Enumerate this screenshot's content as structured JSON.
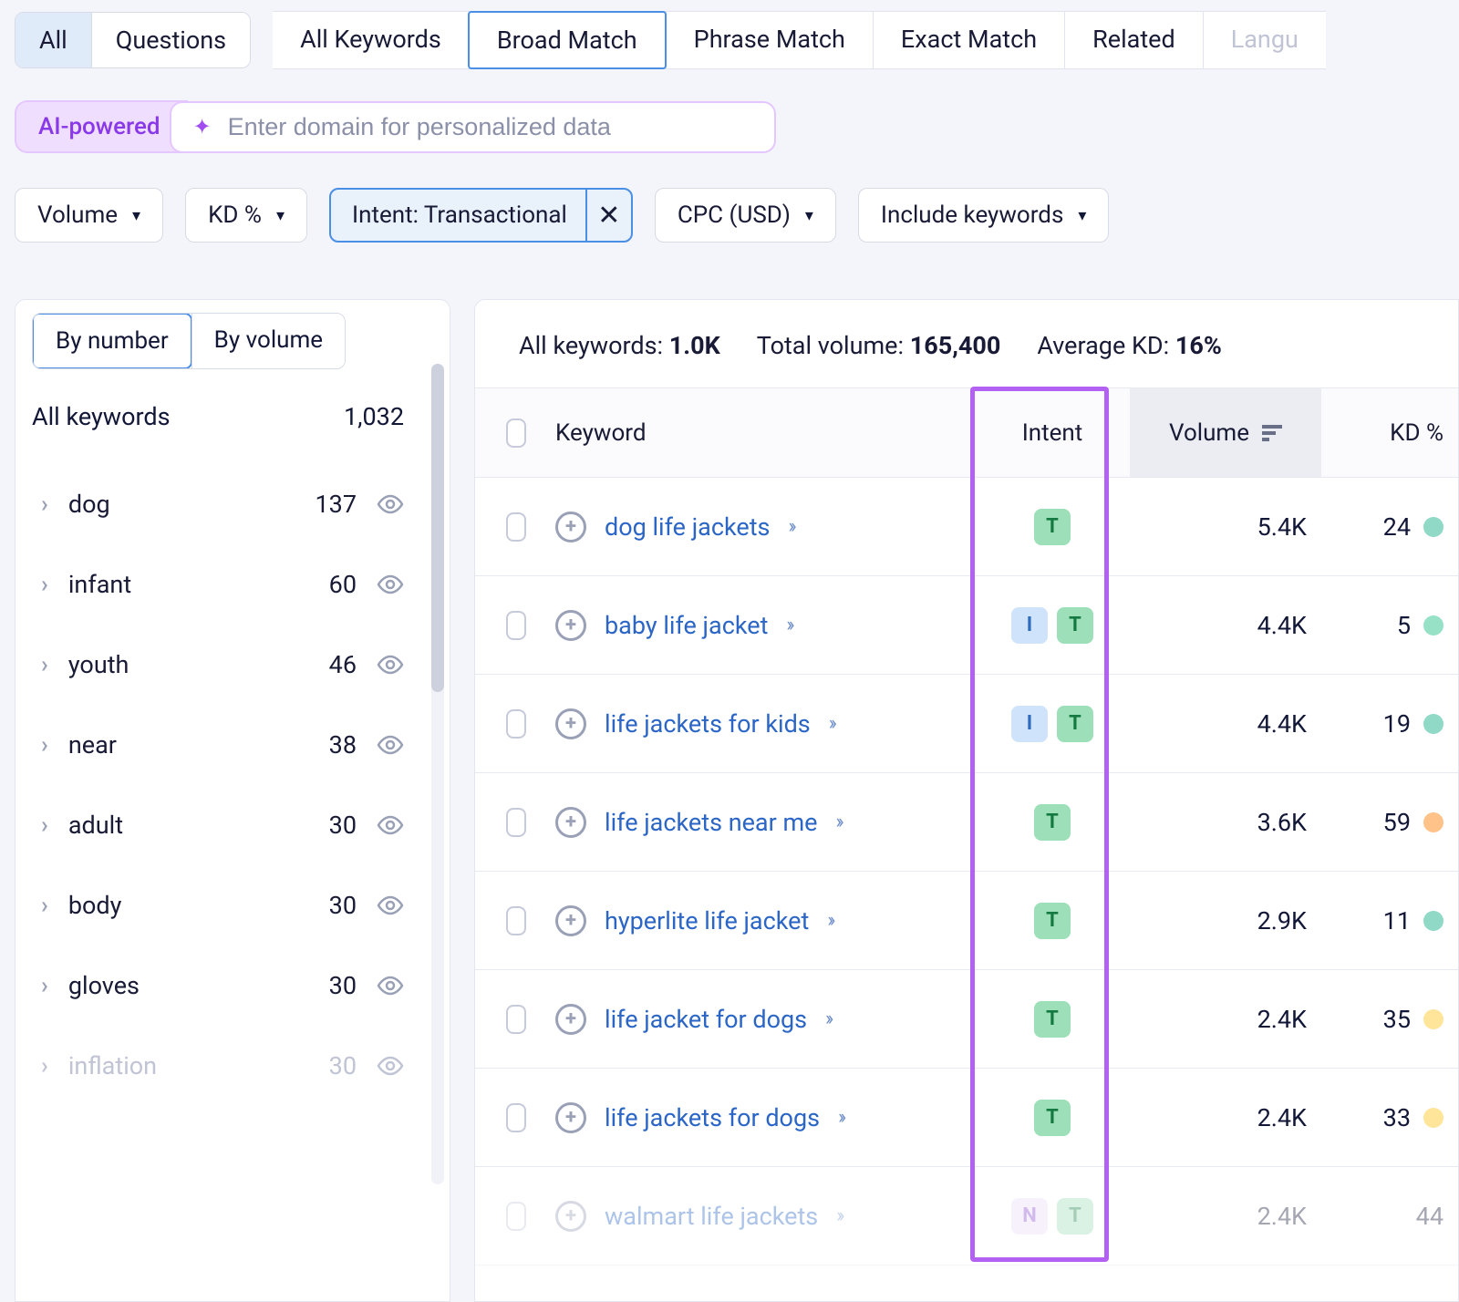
{
  "topTabs": {
    "group1": [
      {
        "label": "All",
        "active": true
      },
      {
        "label": "Questions",
        "active": false
      }
    ],
    "group2": [
      {
        "label": "All Keywords",
        "active": false
      },
      {
        "label": "Broad Match",
        "active": true
      },
      {
        "label": "Phrase Match",
        "active": false
      },
      {
        "label": "Exact Match",
        "active": false
      },
      {
        "label": "Related",
        "active": false
      },
      {
        "label": "Langu",
        "active": false,
        "truncated": true
      }
    ]
  },
  "ai": {
    "chip": "AI-powered",
    "placeholder": "Enter domain for personalized data"
  },
  "filters": {
    "volume": "Volume",
    "kd": "KD %",
    "intent": "Intent: Transactional",
    "cpc": "CPC (USD)",
    "include": "Include keywords"
  },
  "sidebar": {
    "mode": {
      "number": "By number",
      "volume": "By volume"
    },
    "summaryLabel": "All keywords",
    "summaryCount": "1,032",
    "items": [
      {
        "term": "dog",
        "count": "137"
      },
      {
        "term": "infant",
        "count": "60"
      },
      {
        "term": "youth",
        "count": "46"
      },
      {
        "term": "near",
        "count": "38"
      },
      {
        "term": "adult",
        "count": "30"
      },
      {
        "term": "body",
        "count": "30"
      },
      {
        "term": "gloves",
        "count": "30"
      },
      {
        "term": "inflation",
        "count": "30",
        "faded": true
      }
    ]
  },
  "stats": {
    "allLabel": "All keywords:",
    "allValue": "1.0K",
    "totalLabel": "Total volume:",
    "totalValue": "165,400",
    "avgLabel": "Average KD:",
    "avgValue": "16%"
  },
  "columns": {
    "keyword": "Keyword",
    "intent": "Intent",
    "volume": "Volume",
    "kd": "KD %"
  },
  "rows": [
    {
      "kw": "dog life jackets",
      "intents": [
        "T"
      ],
      "volume": "5.4K",
      "kd": "24",
      "dot": "teal"
    },
    {
      "kw": "baby life jacket",
      "intents": [
        "I",
        "T"
      ],
      "volume": "4.4K",
      "kd": "5",
      "dot": "green"
    },
    {
      "kw": "life jackets for kids",
      "intents": [
        "I",
        "T"
      ],
      "volume": "4.4K",
      "kd": "19",
      "dot": "teal"
    },
    {
      "kw": "life jackets near me",
      "intents": [
        "T"
      ],
      "volume": "3.6K",
      "kd": "59",
      "dot": "orange"
    },
    {
      "kw": "hyperlite life jacket",
      "intents": [
        "T"
      ],
      "volume": "2.9K",
      "kd": "11",
      "dot": "teal"
    },
    {
      "kw": "life jacket for dogs",
      "intents": [
        "T"
      ],
      "volume": "2.4K",
      "kd": "35",
      "dot": "yellow"
    },
    {
      "kw": "life jackets for dogs",
      "intents": [
        "T"
      ],
      "volume": "2.4K",
      "kd": "33",
      "dot": "yellow"
    },
    {
      "kw": "walmart life jackets",
      "intents": [
        "N",
        "T"
      ],
      "volume": "2.4K",
      "kd": "44",
      "dot": "",
      "faded": true
    }
  ]
}
